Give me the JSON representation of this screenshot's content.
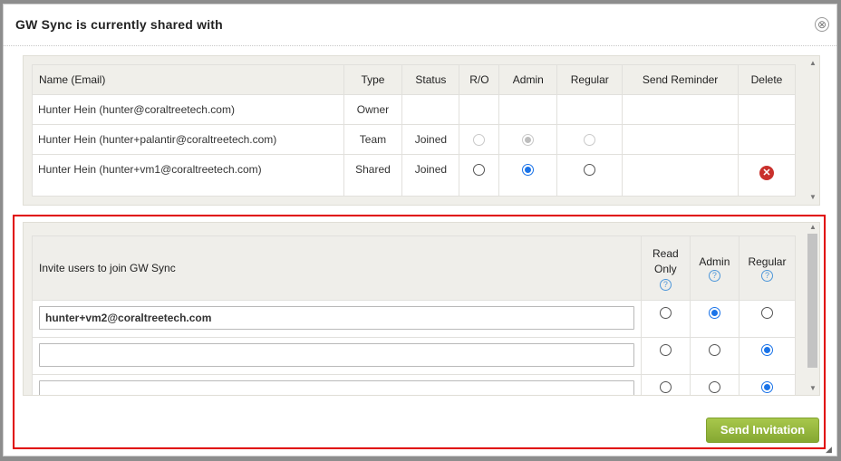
{
  "dialog": {
    "title": "GW Sync is currently shared with",
    "close_icon_glyph": "⊗"
  },
  "members_table": {
    "headers": {
      "name": "Name (Email)",
      "type": "Type",
      "status": "Status",
      "ro": "R/O",
      "admin": "Admin",
      "regular": "Regular",
      "reminder": "Send Reminder",
      "delete": "Delete"
    },
    "rows": [
      {
        "name": "Hunter Hein (hunter@coraltreetech.com)",
        "type": "Owner",
        "status": ""
      },
      {
        "name": "Hunter Hein (hunter+palantir@coraltreetech.com)",
        "type": "Team",
        "status": "Joined"
      },
      {
        "name": "Hunter Hein (hunter+vm1@coraltreetech.com)",
        "type": "Shared",
        "status": "Joined",
        "delete_glyph": "✕"
      }
    ]
  },
  "invite_table": {
    "header_label": "Invite users to join GW Sync",
    "col_read_only": "Read Only",
    "col_admin": "Admin",
    "col_regular": "Regular",
    "help_glyph": "?",
    "rows": [
      {
        "email": "hunter+vm2@coraltreetech.com",
        "selected": "admin"
      },
      {
        "email": "",
        "selected": "regular"
      },
      {
        "email": "",
        "selected": "regular"
      }
    ]
  },
  "footer": {
    "send_label": "Send Invitation"
  },
  "colors": {
    "accent_green": "#95b73c",
    "highlight_red": "#e00000",
    "radio_blue": "#1a73e8",
    "delete_red": "#c9302c"
  }
}
